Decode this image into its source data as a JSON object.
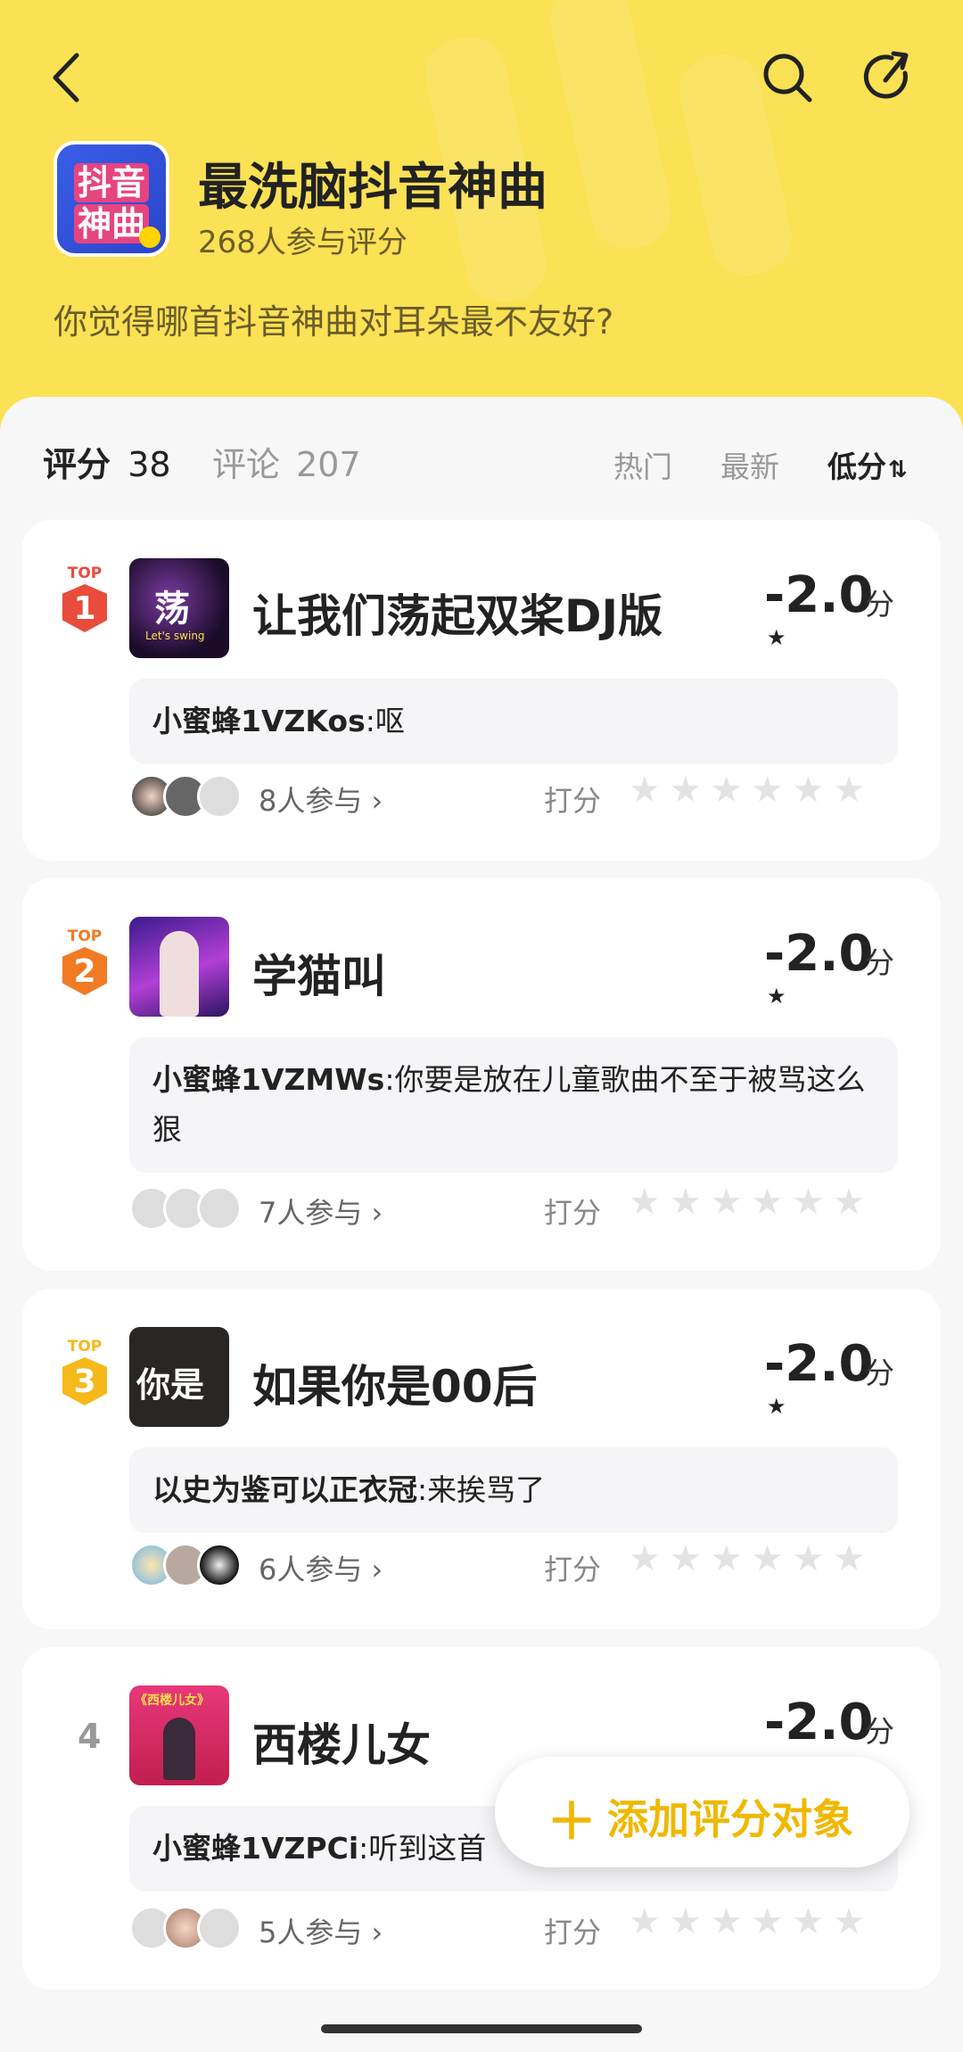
{
  "header": {
    "title": "最洗脑抖音神曲",
    "participants": "268人参与评分",
    "question": "你觉得哪首抖音神曲对耳朵最不友好?",
    "logo_line1": "抖音",
    "logo_line2": "神曲",
    "accent_color": "#fbe154"
  },
  "tabs": {
    "rating_label": "评分",
    "rating_count": "38",
    "comment_label": "评论",
    "comment_count": "207"
  },
  "sort": {
    "hot": "热门",
    "latest": "最新",
    "lowest": "低分",
    "sort_icon": "⇅"
  },
  "items": [
    {
      "rank_top": "TOP",
      "rank": "1",
      "title": "让我们荡起双桨DJ版",
      "score": "-2.0",
      "unit": "分",
      "comment_user": "小蜜蜂1VZKos",
      "comment_sep": ":",
      "comment_text": "呕",
      "participants": "8人参与",
      "rate_label": "打分",
      "cover_text": "荡",
      "cover_sub": "Let's swing",
      "rating_stars": 0.5
    },
    {
      "rank_top": "TOP",
      "rank": "2",
      "title": "学猫叫",
      "score": "-2.0",
      "unit": "分",
      "comment_user": "小蜜蜂1VZMWs",
      "comment_sep": ":",
      "comment_text": "你要是放在儿童歌曲不至于被骂这么狠",
      "participants": "7人参与",
      "rate_label": "打分",
      "rating_stars": 0.5
    },
    {
      "rank_top": "TOP",
      "rank": "3",
      "title": "如果你是00后",
      "score": "-2.0",
      "unit": "分",
      "comment_user": "以史为鉴可以正衣冠",
      "comment_sep": ":",
      "comment_text": "来挨骂了",
      "participants": "6人参与",
      "rate_label": "打分",
      "cover_text": "你是",
      "rating_stars": 0.5
    },
    {
      "rank": "4",
      "title": "西楼儿女",
      "score": "-2.0",
      "unit": "分",
      "comment_user": "小蜜蜂1VZPCi",
      "comment_sep": ":",
      "comment_text": "听到这首",
      "participants": "5人参与",
      "rate_label": "打分",
      "cover_text": "《西楼儿女》",
      "rating_stars": 0.5
    }
  ],
  "fab": {
    "label": "添加评分对象",
    "icon": "plus-icon"
  },
  "colors": {
    "top1": "#e94b3c",
    "top2": "#f07b22",
    "top3": "#f5b91c",
    "fab": "#f0b800"
  }
}
